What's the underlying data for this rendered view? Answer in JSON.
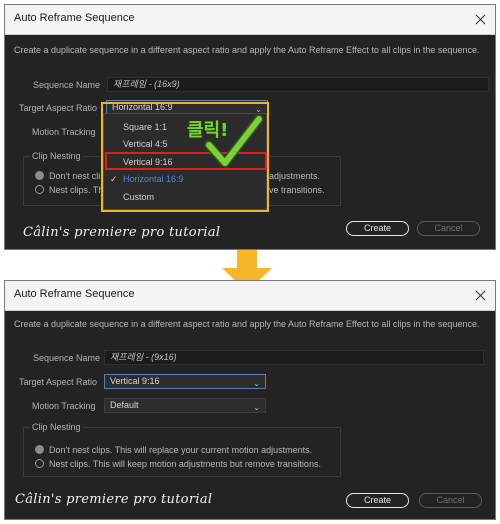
{
  "colors": {
    "dialog_bg": "#232323",
    "highlight_yellow": "#f0b429",
    "highlight_red": "#e0201a",
    "selected_blue": "#4f87d9",
    "arrow": "#f5b62a",
    "check_green": "#7ccf3a"
  },
  "top_dialog": {
    "title": "Auto Reframe Sequence",
    "description": "Create a duplicate sequence in a different aspect ratio and apply the Auto Reframe Effect to all clips in the sequence.",
    "sequence_name_label": "Sequence Name",
    "sequence_name_value": "재프레임 - (16x9)",
    "target_aspect_label": "Target Aspect Ratio",
    "target_aspect_value": "Horizontal 16:9",
    "motion_tracking_label": "Motion Tracking",
    "clip_nesting_label": "Clip Nesting",
    "dont_nest_partial": "Don't nest cli",
    "dont_nest_tail": "adjustments.",
    "nest_partial": "Nest clips. Thi",
    "nest_tail": "ve transitions.",
    "dropdown_options": [
      "Square 1:1",
      "Vertical 4:5",
      "Vertical 9:16",
      "Horizontal 16:9",
      "Custom"
    ],
    "selected_option": "Horizontal 16:9",
    "annotation_text": "클릭!",
    "create_label": "Create",
    "cancel_label": "Cancel",
    "watermark": "Câlin's premiere pro tutorial"
  },
  "bottom_dialog": {
    "title": "Auto Reframe Sequence",
    "description": "Create a duplicate sequence in a different aspect ratio and apply the Auto Reframe Effect to all clips in the sequence.",
    "sequence_name_label": "Sequence Name",
    "sequence_name_value": "재프레임 - (9x16)",
    "target_aspect_label": "Target Aspect Ratio",
    "target_aspect_value": "Vertical 9:16",
    "motion_tracking_label": "Motion Tracking",
    "motion_tracking_value": "Default",
    "clip_nesting_label": "Clip Nesting",
    "dont_nest": "Don't nest clips. This will replace your current motion adjustments.",
    "nest": "Nest clips. This will keep motion adjustments but remove transitions.",
    "create_label": "Create",
    "cancel_label": "Cancel",
    "watermark": "Câlin's premiere pro tutorial"
  }
}
